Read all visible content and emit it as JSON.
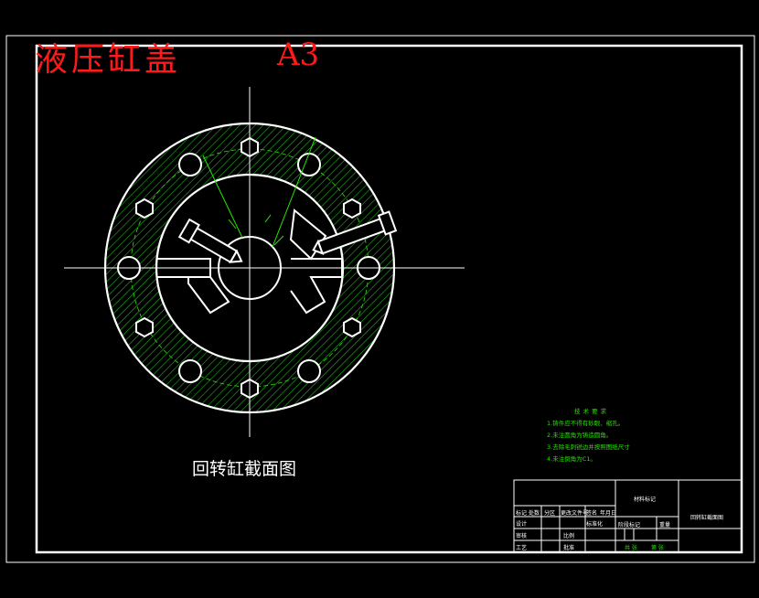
{
  "drawing_title": "液压缸盖",
  "sheet_size": "A3",
  "section_caption": "回转缸截面图",
  "technical_requirements": {
    "heading": "技术要求",
    "items": [
      "1.铸件应不得有砂眼、缩孔。",
      "2.未注圆角为铸造圆角。",
      "3.去除毛刺锐边并按照图纸尺寸",
      "4.未注倒角为C1。"
    ]
  },
  "title_block": {
    "material_label": "材料标记",
    "part_name": "回转缸截面图",
    "row_mark": [
      "标记",
      "处数",
      "分区",
      "更改文件号",
      "签名",
      "年月日"
    ],
    "design": "设计",
    "standardization": "标准化",
    "stage_mark": "阶段标记",
    "weight": "重量",
    "ratio": "比例",
    "drawer": "审核",
    "process": "工艺",
    "approve": "批准",
    "sheets_total": "共 张",
    "sheet_no": "第 张"
  },
  "colors": {
    "hatch": "#1fb01f",
    "construction": "#27e600",
    "outline": "#ffffff",
    "title": "#ff1a1a"
  }
}
